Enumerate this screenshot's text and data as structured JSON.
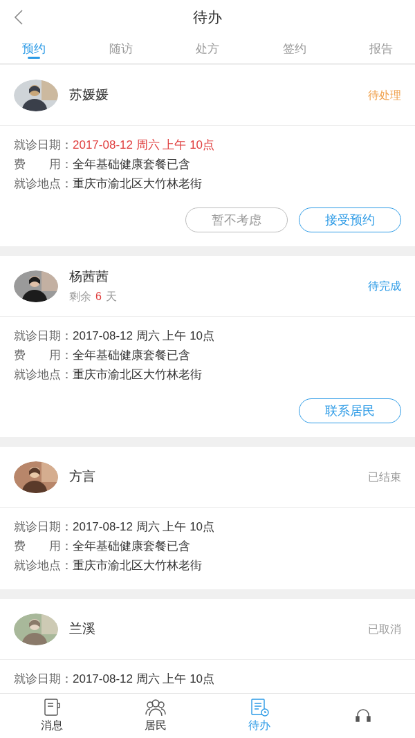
{
  "header": {
    "title": "待办"
  },
  "tabs": [
    {
      "label": "预约",
      "selected": true
    },
    {
      "label": "随访",
      "selected": false
    },
    {
      "label": "处方",
      "selected": false
    },
    {
      "label": "签约",
      "selected": false
    },
    {
      "label": "报告",
      "selected": false
    }
  ],
  "cards": [
    {
      "avatar": {
        "kind": "picture"
      },
      "name": "苏媛媛",
      "status": {
        "label": "待处理",
        "kind": "pending"
      },
      "details": [
        {
          "label": "就诊日期：",
          "value": "2017-08-12 周六 上午 10点",
          "highlight": true
        },
        {
          "label": "费　　用：",
          "value": "全年基础健康套餐已含",
          "highlight": false
        },
        {
          "label": "就诊地点：",
          "value": "重庆市渝北区大竹林老街",
          "highlight": false
        }
      ],
      "actions": [
        {
          "label": "暂不考虑",
          "kind": "secondary"
        },
        {
          "label": "接受预约",
          "kind": "primary"
        }
      ]
    },
    {
      "avatar": {
        "kind": "picture"
      },
      "name": "杨茜茜",
      "remaining": {
        "prefix": "剩余",
        "count": "6",
        "suffix": "天"
      },
      "status": {
        "label": "待完成",
        "kind": "active"
      },
      "details": [
        {
          "label": "就诊日期：",
          "value": "2017-08-12 周六 上午 10点",
          "highlight": false
        },
        {
          "label": "费　　用：",
          "value": "全年基础健康套餐已含",
          "highlight": false
        },
        {
          "label": "就诊地点：",
          "value": "重庆市渝北区大竹林老街",
          "highlight": false
        }
      ],
      "actions": [
        {
          "label": "联系居民",
          "kind": "primary"
        }
      ]
    },
    {
      "avatar": {
        "kind": "picture"
      },
      "name": "方言",
      "status": {
        "label": "已结束",
        "kind": "closed"
      },
      "details": [
        {
          "label": "就诊日期：",
          "value": "2017-08-12 周六 上午 10点",
          "highlight": false
        },
        {
          "label": "费　　用：",
          "value": "全年基础健康套餐已含",
          "highlight": false
        },
        {
          "label": "就诊地点：",
          "value": "重庆市渝北区大竹林老街",
          "highlight": false
        }
      ]
    },
    {
      "avatar": {
        "kind": "picture"
      },
      "name": "兰溪",
      "status": {
        "label": "已取消",
        "kind": "closed"
      },
      "details": [
        {
          "label": "就诊日期：",
          "value": "2017-08-12 周六 上午 10点",
          "highlight": false
        }
      ]
    }
  ],
  "bottom_nav": [
    {
      "label": "消息",
      "kind": "notebook",
      "selected": false
    },
    {
      "label": "居民",
      "kind": "people",
      "selected": false
    },
    {
      "label": "待办",
      "kind": "todo",
      "selected": true
    },
    {
      "kind": "headset",
      "selected": false
    }
  ]
}
